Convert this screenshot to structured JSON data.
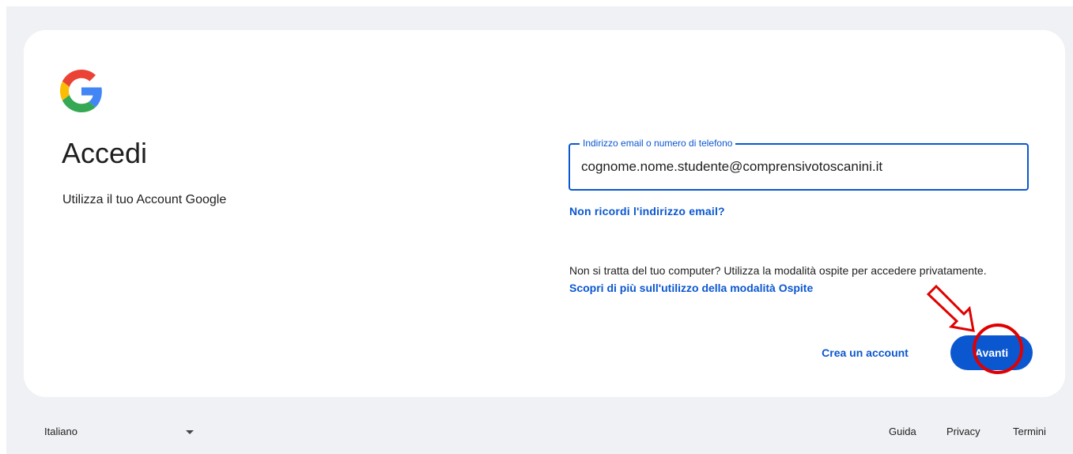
{
  "logo": {
    "icon": "google-g-icon",
    "colors": [
      "#4285F4",
      "#EA4335",
      "#FBBC05",
      "#34A853"
    ]
  },
  "signin": {
    "title": "Accedi",
    "subtitle": "Utilizza il tuo Account Google"
  },
  "email_field": {
    "label": "Indirizzo email o numero di telefono",
    "value": "cognome.nome.studente@comprensivotoscanini.it"
  },
  "forgot_email": "Non ricordi l'indirizzo email?",
  "guest": {
    "text": "Non si tratta del tuo computer? Utilizza la modalità ospite per accedere privatamente.",
    "link": "Scopri di più sull'utilizzo della modalità Ospite"
  },
  "actions": {
    "create_account": "Crea un account",
    "next": "Avanti"
  },
  "annotation": {
    "color": "#e00000"
  },
  "footer": {
    "language": "Italiano",
    "links": [
      "Guida",
      "Privacy",
      "Termini"
    ]
  },
  "colors": {
    "accent": "#0b57d0",
    "background": "#f0f1f4",
    "card": "#ffffff"
  }
}
